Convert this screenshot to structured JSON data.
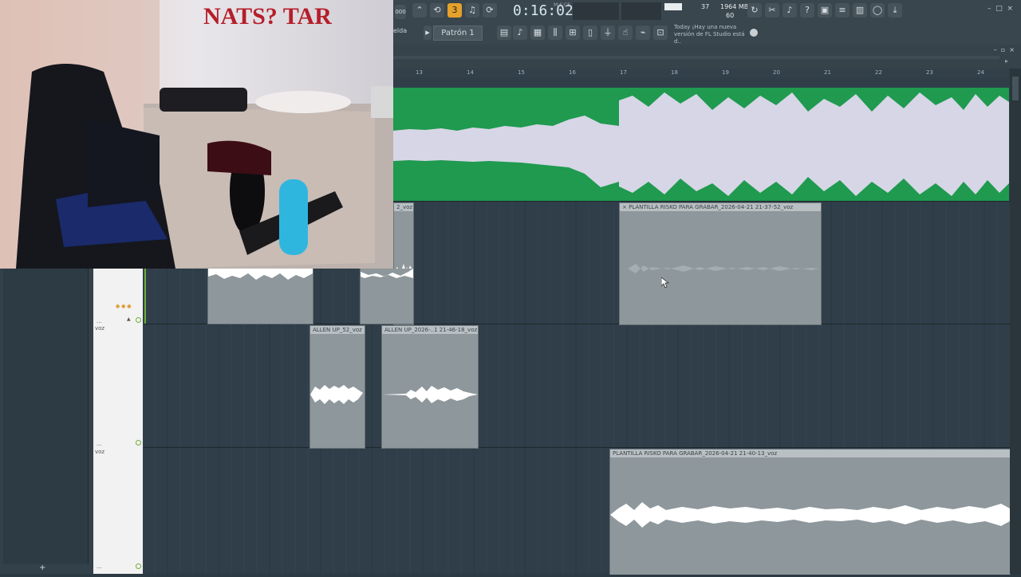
{
  "toolbar": {
    "time": "0:16:02",
    "time_unit": "M:S:CS",
    "cpu": "37",
    "memory": "1964 MB",
    "polyphony": "60",
    "pattern_label": "Patrón 1",
    "snap_label": "elda",
    "notice_day": "Today",
    "notice_text": "¡Hay una nueva versión de FL Studio está d..",
    "mode_label": "000"
  },
  "ruler": {
    "bars": [
      "13",
      "14",
      "15",
      "16",
      "17",
      "18",
      "19",
      "20",
      "21",
      "22",
      "23",
      "24"
    ]
  },
  "clips": {
    "top_partial": "2_voz",
    "plantilla_1": "PLANTILLA RISKO PARA GRABAR_2026-04-21 21-37-52_voz",
    "allen_1": "ALLEN UP_52_voz",
    "allen_2": "ALLEN UP_2026-..1 21-46-18_voz",
    "plantilla_2": "PLANTILLA RISKO PARA GRABAR_2026-04-21 21-40-13_voz"
  },
  "tracks": {
    "track1_name": "voz",
    "track2_name": "voz",
    "dots": "..."
  },
  "bottom": {
    "add_label": "+"
  },
  "colors": {
    "accent": "#e6a12a",
    "waveform_green": "#1f9a4f",
    "grid_bg": "#2f3e48",
    "clip_gray": "#8e979b"
  }
}
